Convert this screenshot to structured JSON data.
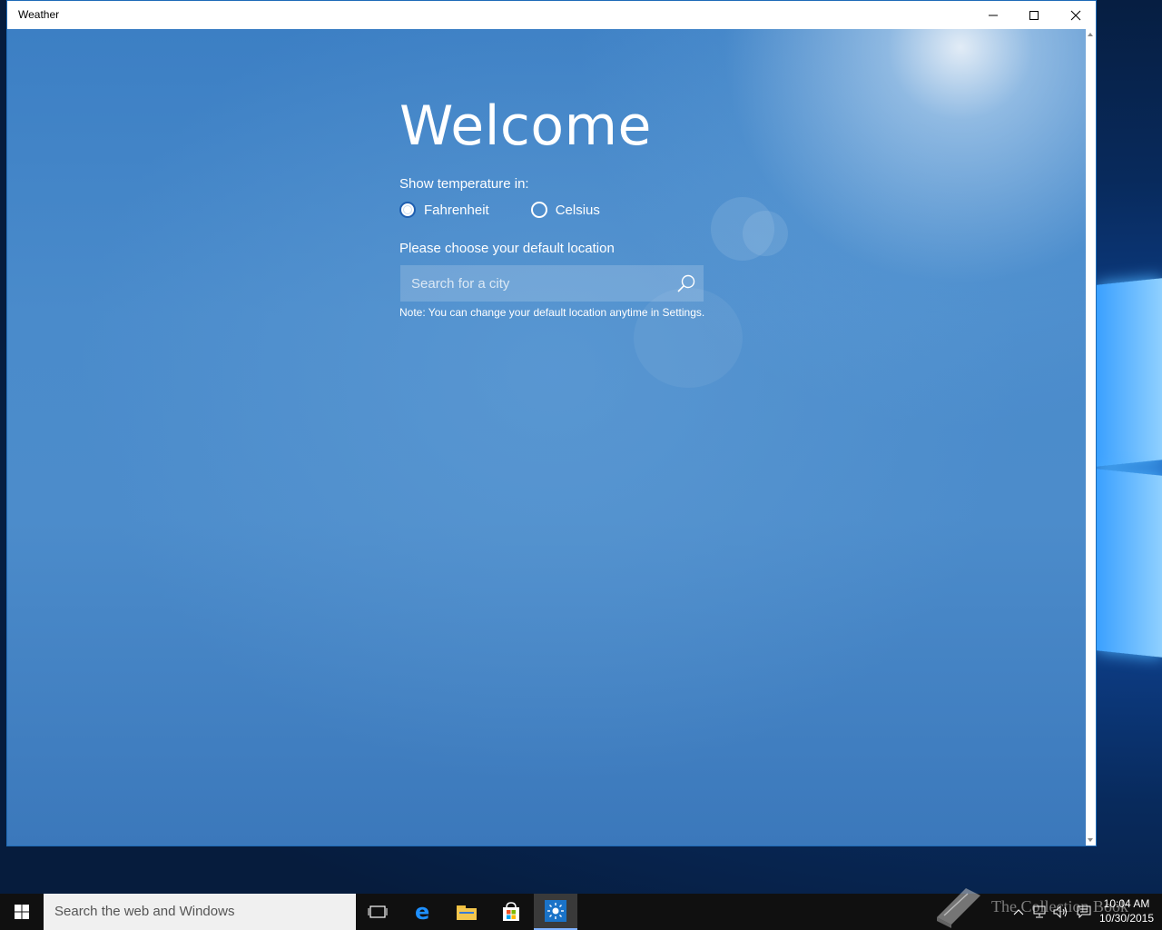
{
  "window": {
    "title": "Weather",
    "controls": [
      "minimize",
      "maximize",
      "close"
    ]
  },
  "welcome": {
    "heading": "Welcome",
    "temperature_label": "Show temperature in:",
    "units": [
      {
        "label": "Fahrenheit",
        "selected": true
      },
      {
        "label": "Celsius",
        "selected": false
      }
    ],
    "location_label": "Please choose your default location",
    "search_placeholder": "Search for a city",
    "note": "Note: You can change your default location anytime in Settings."
  },
  "taskbar": {
    "search_placeholder": "Search the web and Windows",
    "pinned": [
      "task-view-icon",
      "edge-icon",
      "file-explorer-icon",
      "store-icon",
      "weather-icon"
    ],
    "active_app": "weather-icon",
    "watermark": "The Collection Book",
    "time": "10:04 AM",
    "date": "10/30/2015"
  },
  "colors": {
    "accent": "#1e6bb8",
    "content_bg": "#4a8bcb",
    "taskbar": "#101010"
  }
}
